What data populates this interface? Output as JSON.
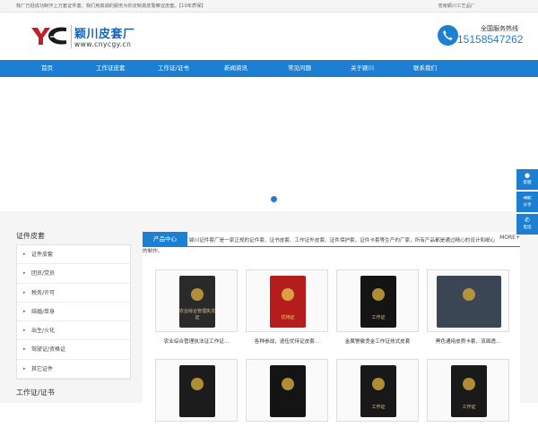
{
  "topbar": {
    "left_text": "我厂已经成功制作上万套证件套，我们用真诚的服务为你定制真皮警察证皮套。【10年质保】",
    "right_text": "苍南颖川工艺品厂"
  },
  "logo": {
    "mark_text": "YC",
    "cn_name": "颖川皮套厂",
    "domain": "www.cnycgy.cn"
  },
  "hotline": {
    "label": "全国服务热线",
    "number": "15158547262",
    "icon": "phone-icon"
  },
  "nav": {
    "items": [
      {
        "label": "首页"
      },
      {
        "label": "工作证皮套"
      },
      {
        "label": "工作证/证书"
      },
      {
        "label": "新闻资讯"
      },
      {
        "label": "常见问题"
      },
      {
        "label": "关于颖川"
      },
      {
        "label": "联系我们"
      }
    ]
  },
  "sidebar": {
    "sections": [
      {
        "title": "证件皮套",
        "items": [
          {
            "label": "证件皮套"
          },
          {
            "label": "团员/党员"
          },
          {
            "label": "税务/许可"
          },
          {
            "label": "结婚/单身"
          },
          {
            "label": "出生/火化"
          },
          {
            "label": "驾驶证/资格证"
          },
          {
            "label": "其它证件"
          }
        ]
      },
      {
        "title": "工作证/证书"
      }
    ]
  },
  "products": {
    "tab_label": "产品中心",
    "more_label": "MORE+",
    "intro": "颖川证件套厂是一家正规的证件套、证书皮套、工作证外皮套、证件保护套、证件卡套等生产的厂家，所有产品都是通过精心的设计和细心的制作。",
    "items": [
      {
        "caption": "农业综合管理执法证工作证...",
        "pic_text": "农业综合管理执法证",
        "tone": "#2a2a2a"
      },
      {
        "caption": "各种参战，退伍优待证皮套...",
        "pic_text": "优待证",
        "tone": "#b51d1d"
      },
      {
        "caption": "金属警徽烫金工作证技式皮套",
        "pic_text": "工作证",
        "tone": "#141414"
      },
      {
        "caption": "黑色通用皮质卡套，双面透...",
        "pic_text": "",
        "tone": "#2c3038"
      },
      {
        "caption": "",
        "pic_text": "",
        "tone": "#1c1c1c"
      },
      {
        "caption": "",
        "pic_text": "",
        "tone": "#141414"
      },
      {
        "caption": "",
        "pic_text": "工作证",
        "tone": "#181818"
      },
      {
        "caption": "",
        "pic_text": "工作证",
        "tone": "#1a1a1a"
      }
    ]
  },
  "float_bar": {
    "items": [
      {
        "label": "客服",
        "icon": "chat-icon"
      },
      {
        "label": "分享",
        "icon": "share-icon"
      },
      {
        "label": "电话",
        "icon": "phone-icon"
      }
    ]
  },
  "colors": {
    "brand_blue": "#1c7fd1",
    "logo_red": "#c41e24"
  }
}
